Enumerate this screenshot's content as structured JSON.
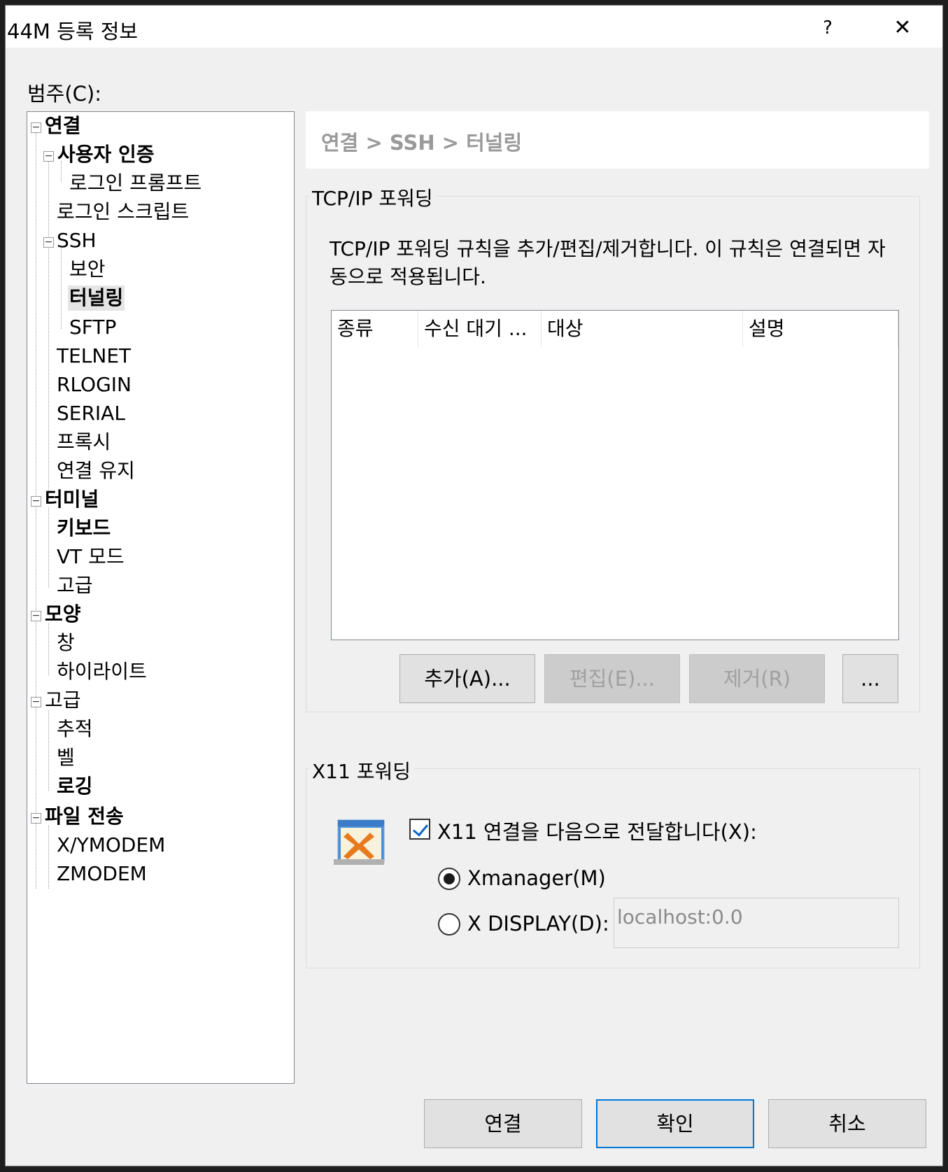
{
  "window": {
    "title": "44M 등록 정보",
    "help_label": "?",
    "close_label": "✕"
  },
  "category_label": "범주(C):",
  "tree": {
    "connection": "연결",
    "user_auth": "사용자 인증",
    "login_prompt": "로그인 프롬프트",
    "login_script": "로그인 스크립트",
    "ssh": "SSH",
    "security": "보안",
    "tunneling": "터널링",
    "sftp": "SFTP",
    "telnet": "TELNET",
    "rlogin": "RLOGIN",
    "serial": "SERIAL",
    "proxy": "프록시",
    "keepalive": "연결 유지",
    "terminal": "터미널",
    "keyboard": "키보드",
    "vt_mode": "VT 모드",
    "terminal_advanced": "고급",
    "appearance": "모양",
    "window_item": "창",
    "highlight": "하이라이트",
    "advanced": "고급",
    "trace": "추적",
    "bell": "벨",
    "logging": "로깅",
    "file_transfer": "파일 전송",
    "xymodem": "X/YMODEM",
    "zmodem": "ZMODEM"
  },
  "breadcrumb": "연결 > SSH > 터널링",
  "tcpip": {
    "group_title": "TCP/IP 포워딩",
    "description": "TCP/IP 포워딩 규칙을 추가/편집/제거합니다. 이 규칙은 연결되면 자동으로 적용됩니다.",
    "columns": [
      "종류",
      "수신 대기 ...",
      "대상",
      "설명"
    ],
    "add_label": "추가(A)...",
    "edit_label": "편집(E)...",
    "remove_label": "제거(R)",
    "more_label": "..."
  },
  "x11": {
    "group_title": "X11 포워딩",
    "forward_checkbox_label": "X11 연결을 다음으로 전달합니다(X):",
    "forward_checked": true,
    "xmanager_label": "Xmanager(M)",
    "xdisplay_label": "X DISPLAY(D):",
    "display_value": "localhost:0.0",
    "selected_option": "Xmanager(M)"
  },
  "buttons": {
    "connect_label": "연결",
    "ok_label": "확인",
    "cancel_label": "취소"
  }
}
